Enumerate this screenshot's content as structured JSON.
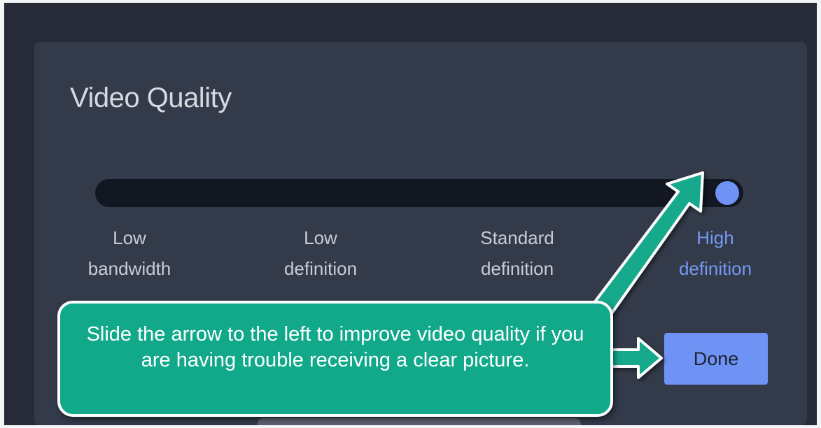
{
  "dialog": {
    "title": "Video Quality",
    "done_label": "Done"
  },
  "slider": {
    "selected_index": 3,
    "levels": [
      {
        "line1": "Low",
        "line2": "bandwidth"
      },
      {
        "line1": "Low",
        "line2": "definition"
      },
      {
        "line1": "Standard",
        "line2": "definition"
      },
      {
        "line1": "High",
        "line2": "definition"
      }
    ]
  },
  "callout": {
    "text": "Slide the arrow to the left to improve video quality if you are having trouble receiving a clear picture."
  },
  "colors": {
    "background": "#262b37",
    "dialog": "#333a4a",
    "track": "#121722",
    "accent": "#6e93f4",
    "callout": "#12a98b"
  }
}
